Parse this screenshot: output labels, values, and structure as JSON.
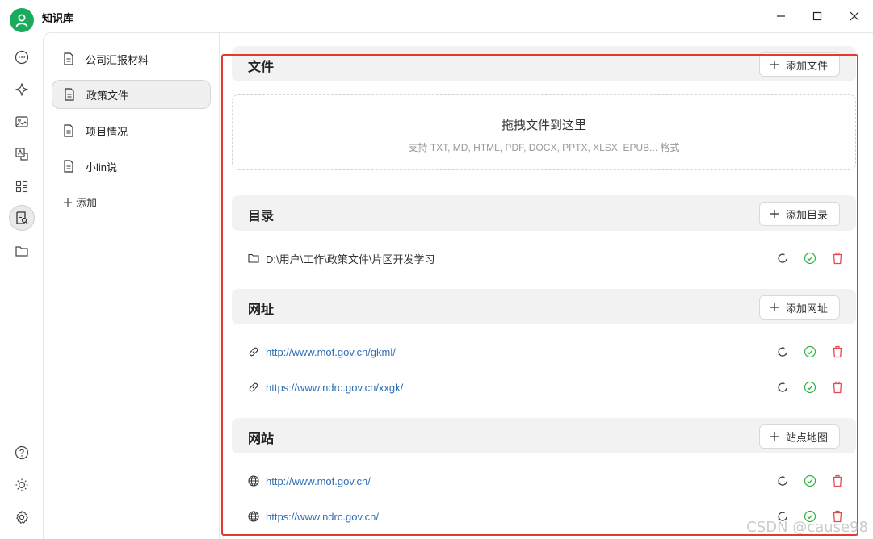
{
  "app": {
    "title": "知识库"
  },
  "rail": {
    "items": [
      "chat-icon",
      "sparkle-icon",
      "image-icon",
      "translate-icon",
      "apps-icon",
      "knowledge-icon",
      "folder-icon"
    ],
    "bottom": [
      "help-icon",
      "theme-icon",
      "settings-icon"
    ]
  },
  "sidebar": {
    "items": [
      {
        "label": "公司汇报材料"
      },
      {
        "label": "政策文件"
      },
      {
        "label": "项目情况"
      },
      {
        "label": "小lin说"
      }
    ],
    "add_label": "添加",
    "active_index": 1
  },
  "files": {
    "title": "文件",
    "add_label": "添加文件",
    "drop_title": "拖拽文件到这里",
    "drop_hint": "支持 TXT, MD, HTML, PDF, DOCX, PPTX, XLSX, EPUB... 格式"
  },
  "directories": {
    "title": "目录",
    "add_label": "添加目录",
    "items": [
      {
        "path": "D:\\用户\\工作\\政策文件\\片区开发学习"
      }
    ]
  },
  "urls": {
    "title": "网址",
    "add_label": "添加网址",
    "items": [
      {
        "url": "http://www.mof.gov.cn/gkml/"
      },
      {
        "url": "https://www.ndrc.gov.cn/xxgk/"
      }
    ]
  },
  "websites": {
    "title": "网站",
    "add_label": "站点地图",
    "items": [
      {
        "url": "http://www.mof.gov.cn/"
      },
      {
        "url": "https://www.ndrc.gov.cn/"
      }
    ]
  },
  "colors": {
    "accent": "#1aab5c",
    "link": "#2f6eb5",
    "success": "#2fb344",
    "danger": "#e5484d",
    "highlight_border": "#e03a34"
  },
  "watermark": "CSDN @cause98"
}
